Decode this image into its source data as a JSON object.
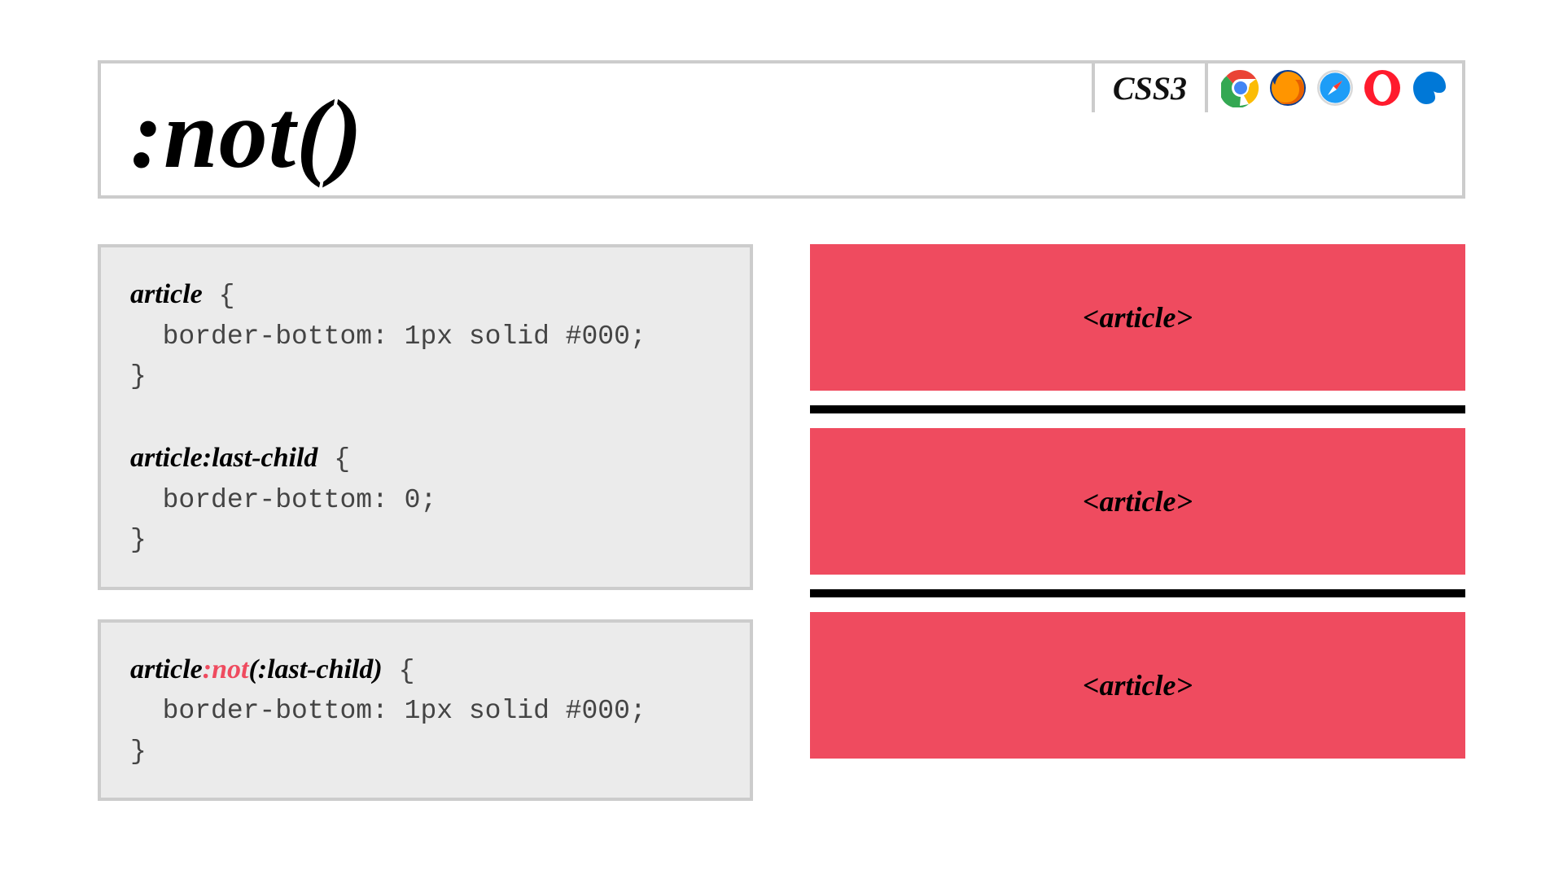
{
  "header": {
    "title": ":not()",
    "spec_badge": "CSS3",
    "browsers": [
      "chrome-icon",
      "firefox-icon",
      "safari-icon",
      "opera-icon",
      "edge-icon"
    ]
  },
  "code": {
    "block1": {
      "sel1": "article",
      "open1": " {",
      "line1": "  border-bottom: 1px solid #000;",
      "close1": "}",
      "blank": "",
      "sel2": "article:last-child",
      "open2": " {",
      "line2": "  border-bottom: 0;",
      "close2": "}"
    },
    "block2": {
      "sel_pre": "article",
      "sel_not": ":not",
      "sel_post": "(:last-child)",
      "open": " {",
      "line1": "  border-bottom: 1px solid #000;",
      "close": "}"
    }
  },
  "preview": {
    "article_label": "<article>"
  },
  "colors": {
    "accent": "#ef4b5f",
    "border": "#ccc",
    "code_bg": "#ebebeb"
  }
}
